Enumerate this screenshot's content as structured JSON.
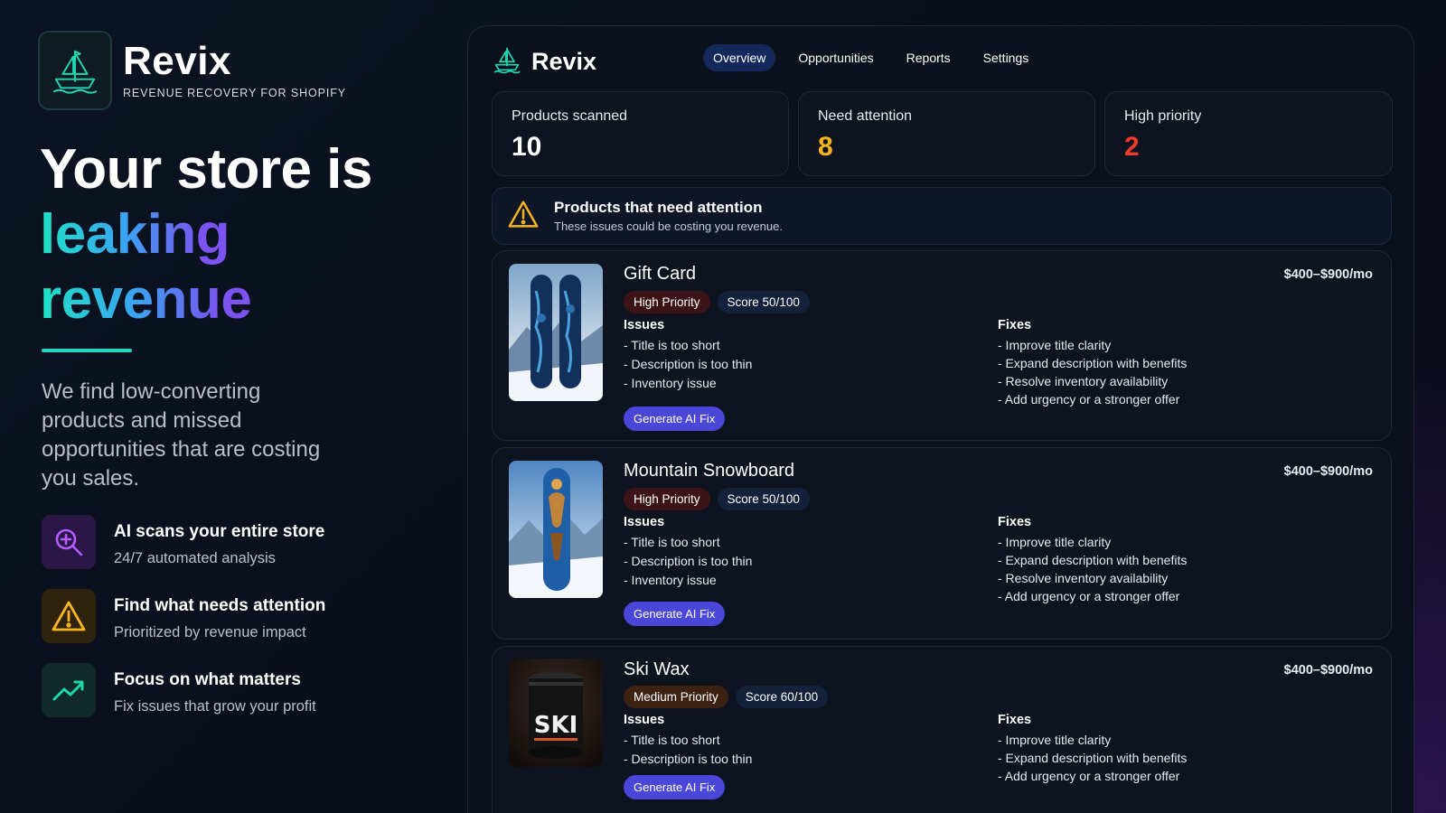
{
  "brand": {
    "name": "Revix",
    "tagline": "REVENUE RECOVERY FOR SHOPIFY"
  },
  "hero": {
    "line1": "Your store is",
    "line2": "leaking",
    "line3": "revenue",
    "description": "We find low-converting products and missed opportunities that are costing you sales.",
    "gradient_colors": [
      "#1fe3c5",
      "#3aa3f2",
      "#7b53f0"
    ]
  },
  "features": [
    {
      "icon": "magnifier-plus-icon",
      "title": "AI scans your entire store",
      "desc": "24/7 automated analysis",
      "color": "#a64dff"
    },
    {
      "icon": "warning-icon",
      "title": "Find what needs attention",
      "desc": "Prioritized by revenue impact",
      "color": "#f4b521"
    },
    {
      "icon": "trending-up-icon",
      "title": "Focus on what matters",
      "desc": "Fix issues that grow your profit",
      "color": "#1fd7a8"
    }
  ],
  "app": {
    "name": "Revix",
    "nav": [
      "Overview",
      "Opportunities",
      "Reports",
      "Settings"
    ],
    "active_nav": "Overview",
    "stats": [
      {
        "label": "Products scanned",
        "value": "10",
        "color": "#ffffff"
      },
      {
        "label": "Need attention",
        "value": "8",
        "color": "#f4b521"
      },
      {
        "label": "High priority",
        "value": "2",
        "color": "#ef3b2d"
      }
    ],
    "alert": {
      "title": "Products that need attention",
      "subtitle": "These issues could be costing you revenue."
    },
    "issues_label": "Issues",
    "fixes_label": "Fixes",
    "button_label": "Generate AI Fix",
    "products": [
      {
        "name": "Gift Card",
        "priority": "High Priority",
        "score": "Score 50/100",
        "price": "$400–$900/mo",
        "issues": [
          "- Title is too short",
          "- Description is too thin",
          "- Inventory issue"
        ],
        "fixes": [
          "- Improve title clarity",
          "- Expand description with benefits",
          "- Resolve inventory availability",
          "- Add urgency or a stronger offer"
        ]
      },
      {
        "name": "Mountain Snowboard",
        "priority": "High Priority",
        "score": "Score 50/100",
        "price": "$400–$900/mo",
        "issues": [
          "- Title is too short",
          "- Description is too thin",
          "- Inventory issue"
        ],
        "fixes": [
          "- Improve title clarity",
          "- Expand description with benefits",
          "- Resolve inventory availability",
          "- Add urgency or a stronger offer"
        ]
      },
      {
        "name": "Ski Wax",
        "priority": "Medium Priority",
        "score": "Score 60/100",
        "price": "$400–$900/mo",
        "product_label": "SKI",
        "issues": [
          "- Title is too short",
          "- Description is too thin"
        ],
        "fixes": [
          "- Improve title clarity",
          "- Expand description with benefits",
          "- Add urgency or a stronger offer"
        ]
      }
    ]
  }
}
